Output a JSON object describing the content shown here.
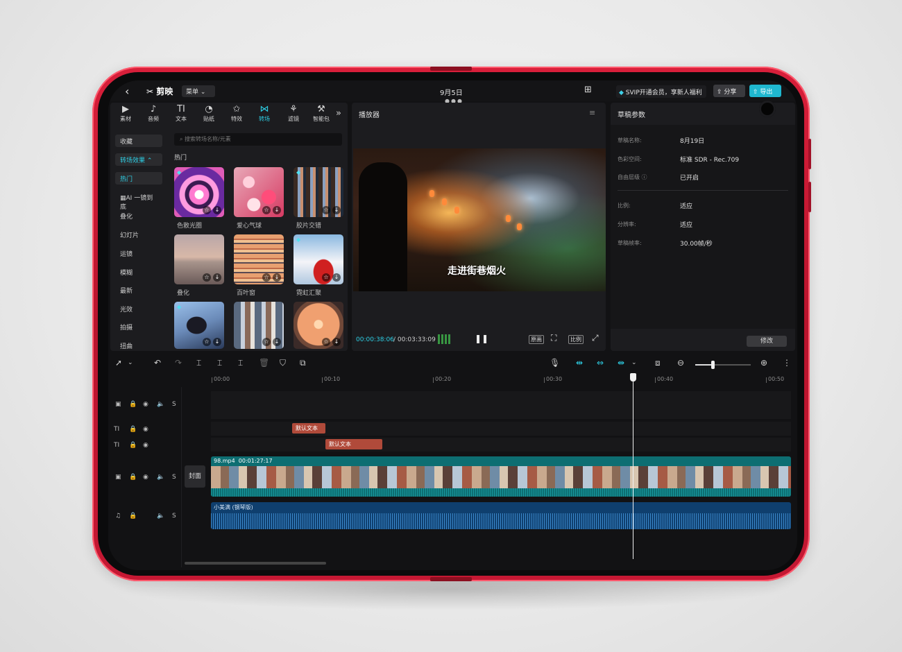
{
  "topbar": {
    "back_icon": "‹",
    "logo": "剪映",
    "menu": "菜单",
    "date": "9月5日",
    "svip": "SVIP开通会员，享新人福利",
    "share": "分享",
    "export": "导出"
  },
  "tools": [
    {
      "label": "素材",
      "icon": "▶"
    },
    {
      "label": "音频",
      "icon": "♪"
    },
    {
      "label": "文本",
      "icon": "TI"
    },
    {
      "label": "贴纸",
      "icon": "◔"
    },
    {
      "label": "特效",
      "icon": "✩"
    },
    {
      "label": "转场",
      "icon": "⋈"
    },
    {
      "label": "滤镜",
      "icon": "⚘"
    },
    {
      "label": "智能包",
      "icon": "⚒"
    }
  ],
  "categories": [
    "收藏",
    "转场效果",
    "热门",
    "AI 一镜到底",
    "叠化",
    "幻灯片",
    "运镜",
    "模糊",
    "最新",
    "光效",
    "拍摄",
    "扭曲"
  ],
  "search_placeholder": "搜索转场名称/元素",
  "hot_label": "热门",
  "transitions": [
    "色散光圈",
    "爱心气球",
    "胶片交错",
    "叠化",
    "百叶窗",
    "霓虹汇聚"
  ],
  "player": {
    "title": "播放器",
    "subtitle": "走进街巷烟火",
    "current_time": "00:00:38:06",
    "total_time": "00:03:33:09",
    "original_btn": "原画",
    "ratio_btn": "比例"
  },
  "params": {
    "title": "草稿参数",
    "rows": [
      {
        "label": "草稿名称:",
        "value": "8月19日"
      },
      {
        "label": "色彩空间:",
        "value": "标准 SDR - Rec.709"
      },
      {
        "label": "自由层级 ⓘ",
        "value": "已开启"
      },
      {
        "label": "比例:",
        "value": "适应"
      },
      {
        "label": "分辨率:",
        "value": "适应"
      },
      {
        "label": "草稿帧率:",
        "value": "30.00帧/秒"
      }
    ],
    "modify": "修改"
  },
  "ruler": [
    "00:00",
    "00:10",
    "00:20",
    "00:30",
    "00:40",
    "00:50"
  ],
  "timeline": {
    "text_clip_1": "默认文本",
    "text_clip_2": "默认文本",
    "cover": "封面",
    "video_name": "98.mp4",
    "video_duration": "00:01:27:17",
    "audio_name": "小美满 (钢琴版)",
    "playhead_seconds": 38.2
  },
  "colors": {
    "accent": "#2ed0e6",
    "device": "#c51833",
    "video_track": "#0d6e72",
    "audio_track": "#0f3f6e",
    "text_clip": "#b04a3a"
  }
}
